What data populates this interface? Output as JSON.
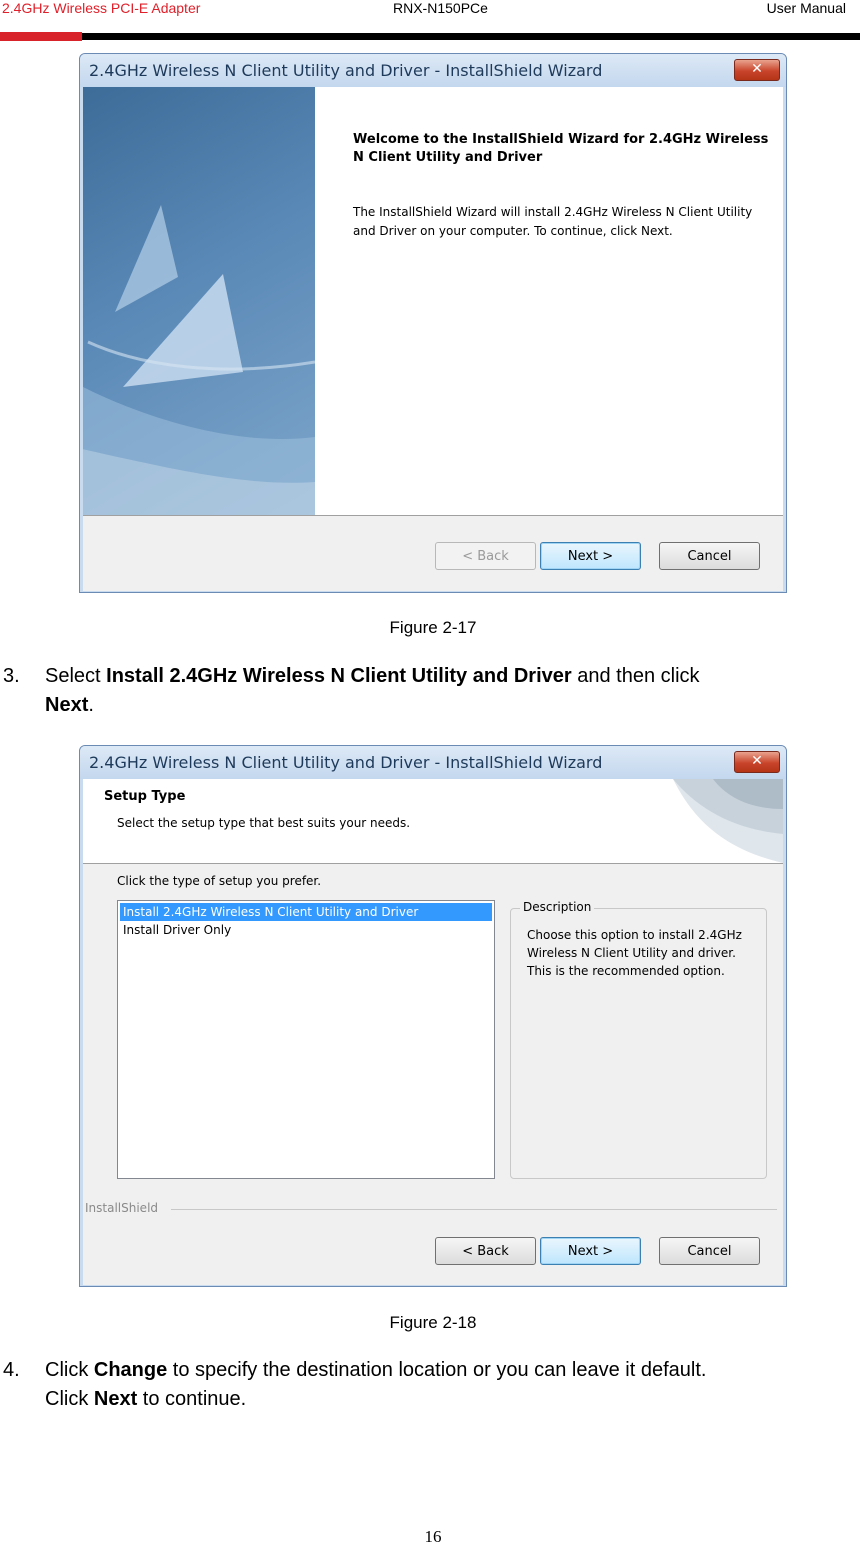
{
  "header": {
    "left": "2.4GHz Wireless PCI-E Adapter",
    "center": "RNX-N150PCe",
    "right": "User Manual"
  },
  "figure1": {
    "window_title": "2.4GHz Wireless N Client Utility and Driver - InstallShield Wizard",
    "close_label": "✕",
    "welcome_title": "Welcome to the InstallShield Wizard for 2.4GHz Wireless N Client Utility and Driver",
    "welcome_body": "The InstallShield Wizard will install 2.4GHz Wireless N Client Utility and Driver on your computer.  To continue, click Next.",
    "back_label": "< Back",
    "next_label": "Next >",
    "cancel_label": "Cancel",
    "caption": "Figure 2-17"
  },
  "step3": {
    "num": "3.",
    "pre": "Select ",
    "bold1": "Install 2.4GHz Wireless N Client Utility and Driver",
    "mid": " and then click ",
    "bold2": "Next",
    "post": "."
  },
  "figure2": {
    "window_title": "2.4GHz Wireless N Client Utility and Driver - InstallShield Wizard",
    "close_label": "✕",
    "section_title": "Setup Type",
    "section_sub": "Select the setup type that best suits your needs.",
    "prefer_label": "Click the type of setup you prefer.",
    "options": [
      "Install 2.4GHz Wireless N Client Utility and Driver",
      "Install Driver Only"
    ],
    "description_label": "Description",
    "description_text": "Choose this option to install 2.4GHz Wireless N Client Utility and driver. This is the recommended option.",
    "installshield_label": "InstallShield",
    "back_label": "< Back",
    "next_label": "Next >",
    "cancel_label": "Cancel",
    "caption": "Figure 2-18"
  },
  "step4": {
    "num": "4.",
    "pre": "Click ",
    "bold1": "Change",
    "mid": " to specify the destination location or you can leave it default.",
    "line2_pre": "Click ",
    "bold2": "Next",
    "line2_post": " to continue."
  },
  "footer": {
    "page_number": "16"
  }
}
